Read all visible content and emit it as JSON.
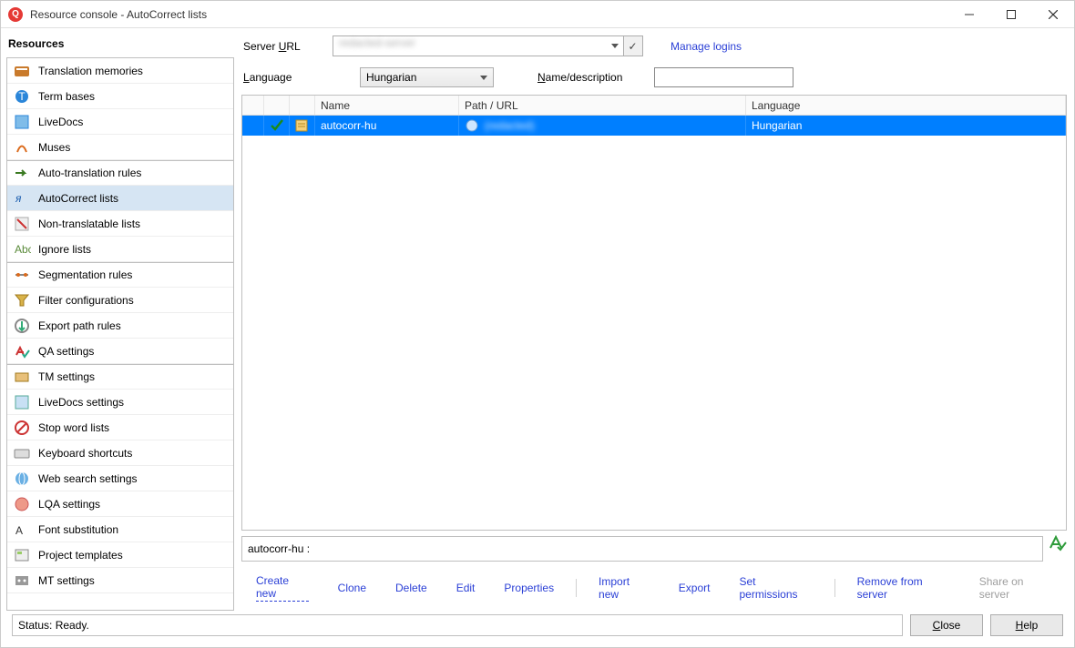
{
  "window": {
    "title": "Resource console - AutoCorrect lists"
  },
  "sidebar": {
    "heading": "Resources",
    "items": [
      {
        "label": "Translation memories",
        "icon": "tm"
      },
      {
        "label": "Term bases",
        "icon": "tb"
      },
      {
        "label": "LiveDocs",
        "icon": "ld"
      },
      {
        "label": "Muses",
        "icon": "muse"
      },
      {
        "label": "Auto-translation rules",
        "icon": "atr",
        "sep": true
      },
      {
        "label": "AutoCorrect lists",
        "icon": "acl",
        "selected": true
      },
      {
        "label": "Non-translatable lists",
        "icon": "ntl"
      },
      {
        "label": "Ignore lists",
        "icon": "ign"
      },
      {
        "label": "Segmentation rules",
        "icon": "seg",
        "sep": true
      },
      {
        "label": "Filter configurations",
        "icon": "fil"
      },
      {
        "label": "Export path rules",
        "icon": "exp"
      },
      {
        "label": "QA settings",
        "icon": "qa"
      },
      {
        "label": "TM settings",
        "icon": "tms",
        "sep": true
      },
      {
        "label": "LiveDocs settings",
        "icon": "lds"
      },
      {
        "label": "Stop word lists",
        "icon": "swl"
      },
      {
        "label": "Keyboard shortcuts",
        "icon": "kbd"
      },
      {
        "label": "Web search settings",
        "icon": "wss"
      },
      {
        "label": "LQA settings",
        "icon": "lqa"
      },
      {
        "label": "Font substitution",
        "icon": "font"
      },
      {
        "label": "Project templates",
        "icon": "ptpl"
      },
      {
        "label": "MT settings",
        "icon": "mts"
      }
    ]
  },
  "filters": {
    "serverUrlLabelPre": "Server ",
    "serverUrlLabelU": "U",
    "serverUrlLabelPost": "RL",
    "serverUrlValue": "redacted-server",
    "manageLogins": "Manage logins",
    "languageLabelU": "L",
    "languageLabelPost": "anguage",
    "languageValue": "Hungarian",
    "nameLabelU": "N",
    "nameLabelPost": "ame/description",
    "nameValue": ""
  },
  "grid": {
    "headers": {
      "name": "Name",
      "path": "Path / URL",
      "lang": "Language"
    },
    "rows": [
      {
        "name": "autocorr-hu",
        "path": "(redacted)",
        "lang": "Hungarian"
      }
    ]
  },
  "detail": {
    "text": "autocorr-hu  :"
  },
  "actions": {
    "createNew": "Create new",
    "clone": "Clone",
    "delete": "Delete",
    "edit": "Edit",
    "properties": "Properties",
    "importNew": "Import new",
    "export": "Export",
    "setPermissions": "Set permissions",
    "removeFromServer": "Remove from server",
    "shareOnServer": "Share on server"
  },
  "footer": {
    "status": "Status: Ready.",
    "close": "Close",
    "closeU": "C",
    "closePost": "lose",
    "help": "Help",
    "helpU": "H",
    "helpPost": "elp"
  }
}
